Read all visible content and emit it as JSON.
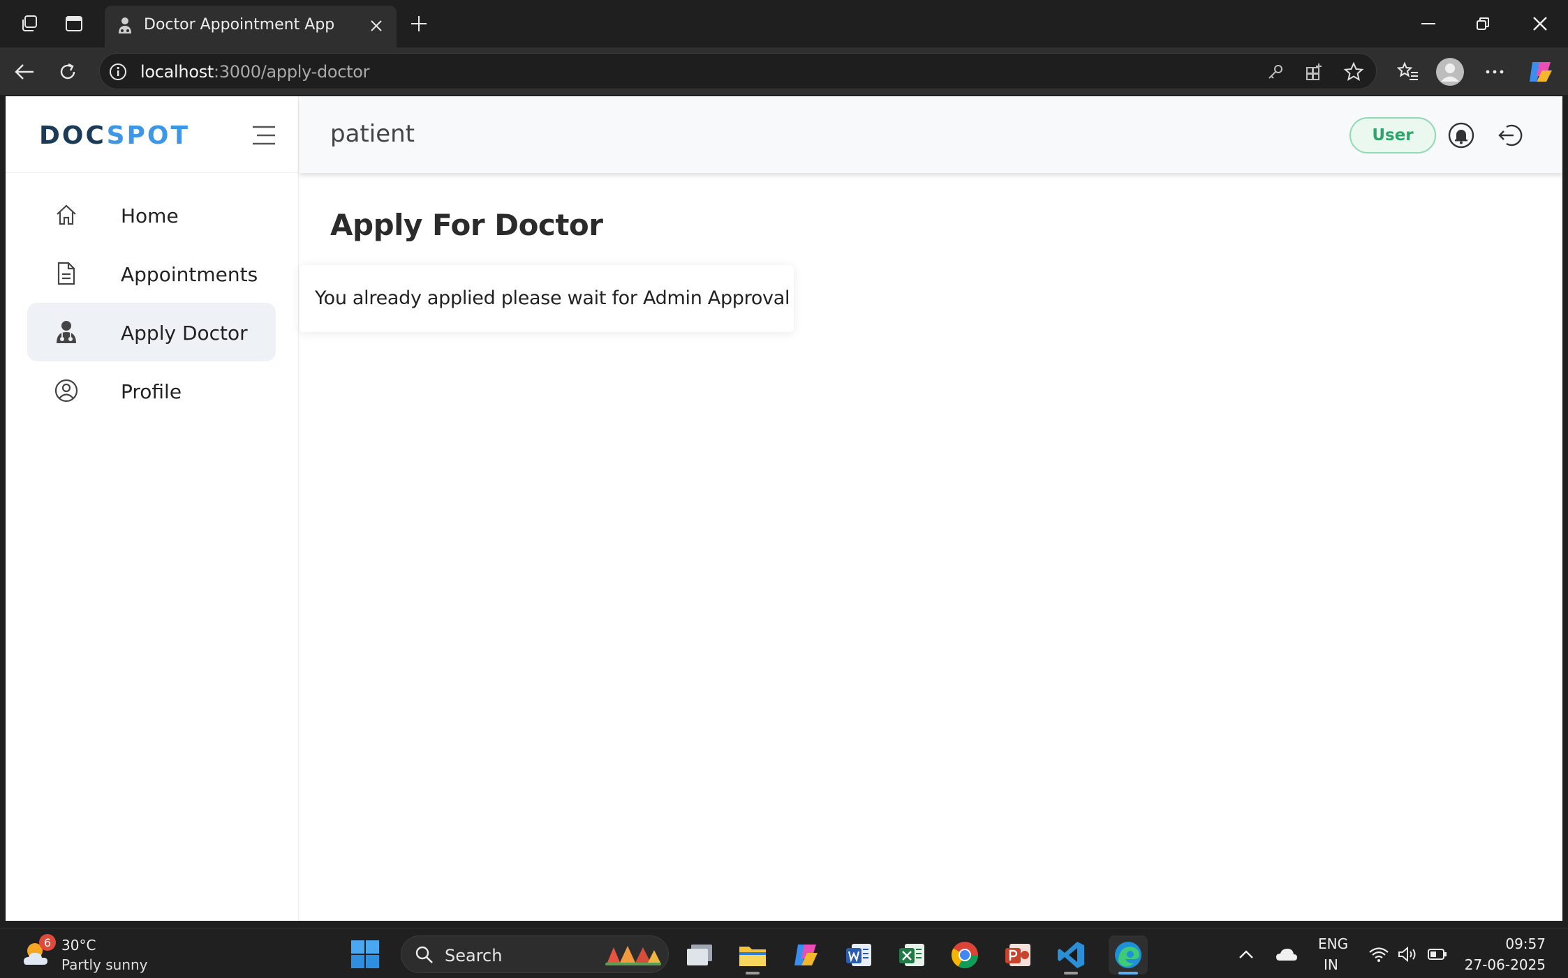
{
  "browser": {
    "tab_title": "Doctor Appointment App",
    "url_host": "localhost",
    "url_path": ":3000/apply-doctor"
  },
  "sidebar": {
    "logo_part1": "DOC",
    "logo_part2": "SPOT",
    "items": [
      {
        "label": "Home",
        "icon": "home-icon",
        "active": false
      },
      {
        "label": "Appointments",
        "icon": "document-icon",
        "active": false
      },
      {
        "label": "Apply Doctor",
        "icon": "doctor-icon",
        "active": true
      },
      {
        "label": "Profile",
        "icon": "user-circle-icon",
        "active": false
      }
    ]
  },
  "header": {
    "title": "patient",
    "role_badge": "User"
  },
  "main": {
    "title": "Apply For Doctor",
    "notice": "You already applied please wait for Admin Approval"
  },
  "taskbar": {
    "weather_badge": "6",
    "weather_temp": "30°C",
    "weather_desc": "Partly sunny",
    "search_label": "Search",
    "lang_line1": "ENG",
    "lang_line2": "IN",
    "time": "09:57",
    "date": "27-06-2025"
  },
  "colors": {
    "logo_dark": "#1c3b57",
    "logo_accent": "#3c97e6",
    "badge_green": "#2ea56b",
    "active_item_bg": "#eef2f7"
  }
}
